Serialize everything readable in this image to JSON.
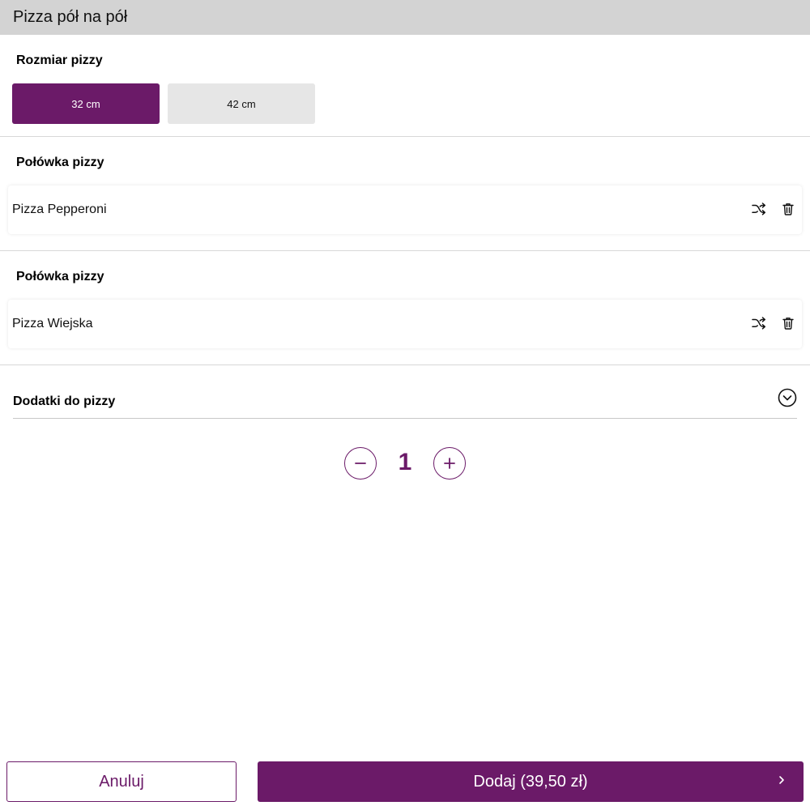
{
  "dialog": {
    "title": "Pizza pół na pół"
  },
  "size_section": {
    "label": "Rozmiar pizzy",
    "options": [
      {
        "label": "32 cm",
        "selected": true
      },
      {
        "label": "42 cm",
        "selected": false
      }
    ]
  },
  "halves": [
    {
      "label": "Połówka pizzy",
      "pizza": "Pizza Pepperoni",
      "icons": [
        "shuffle-icon",
        "trash-icon"
      ]
    },
    {
      "label": "Połówka pizzy",
      "pizza": "Pizza Wiejska",
      "icons": [
        "shuffle-icon",
        "trash-icon"
      ]
    }
  ],
  "addons": {
    "label": "Dodatki do pizzy",
    "icon": "chevron-down-circle-icon"
  },
  "quantity": {
    "value": "1",
    "decrement_icon": "minus-icon",
    "increment_icon": "plus-icon"
  },
  "footer": {
    "cancel_label": "Anuluj",
    "add_label": "Dodaj (39,50 zł)",
    "add_icon": "chevron-right-icon"
  },
  "colors": {
    "accent": "#6b1a68",
    "title_bar": "#d3d3d3",
    "unselected_option": "#e6e6e6"
  }
}
